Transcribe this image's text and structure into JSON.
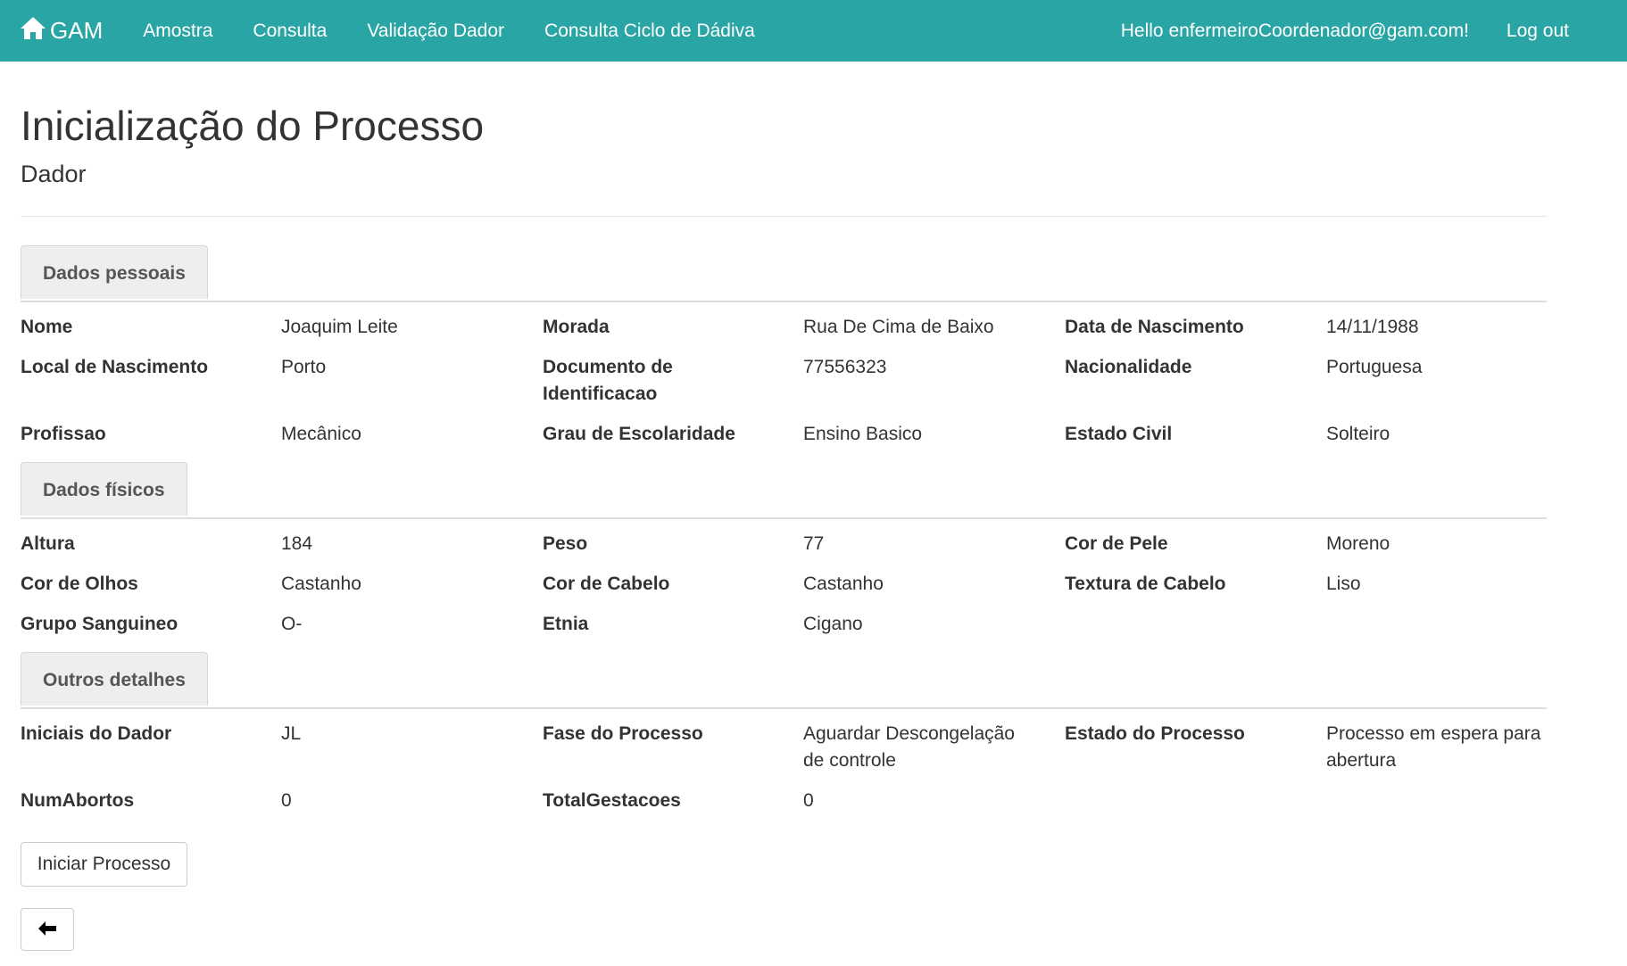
{
  "navbar": {
    "brand": "GAM",
    "links": [
      "Amostra",
      "Consulta",
      "Validação Dador",
      "Consulta Ciclo de Dádiva"
    ],
    "greeting": "Hello enfermeiroCoordenador@gam.com!",
    "logout": "Log out",
    "color": "#2aa5a5"
  },
  "page": {
    "title": "Inicialização do Processo",
    "subtitle": "Dador"
  },
  "sections": {
    "dados_pessoais": {
      "tab": "Dados pessoais",
      "nome": {
        "label": "Nome",
        "value": "Joaquim Leite"
      },
      "morada": {
        "label": "Morada",
        "value": "Rua De Cima de Baixo"
      },
      "data_nascimento": {
        "label": "Data de Nascimento",
        "value": "14/11/1988"
      },
      "local_nascimento": {
        "label": "Local de Nascimento",
        "value": "Porto"
      },
      "documento": {
        "label_line1": "Documento de",
        "label_line2": "Identificacao",
        "value": "77556323"
      },
      "nacionalidade": {
        "label": "Nacionalidade",
        "value": "Portuguesa"
      },
      "profissao": {
        "label": "Profissao",
        "value": "Mecânico"
      },
      "escolaridade": {
        "label": "Grau de Escolaridade",
        "value": "Ensino Basico"
      },
      "estado_civil": {
        "label": "Estado Civil",
        "value": "Solteiro"
      }
    },
    "dados_fisicos": {
      "tab": "Dados físicos",
      "altura": {
        "label": "Altura",
        "value": "184"
      },
      "peso": {
        "label": "Peso",
        "value": "77"
      },
      "cor_pele": {
        "label": "Cor de Pele",
        "value": "Moreno"
      },
      "cor_olhos": {
        "label": "Cor de Olhos",
        "value": "Castanho"
      },
      "cor_cabelo": {
        "label": "Cor de Cabelo",
        "value": "Castanho"
      },
      "textura_cabelo": {
        "label": "Textura de Cabelo",
        "value": "Liso"
      },
      "grupo_sanguineo": {
        "label": "Grupo Sanguineo",
        "value": "O-"
      },
      "etnia": {
        "label": "Etnia",
        "value": "Cigano"
      }
    },
    "outros_detalhes": {
      "tab": "Outros detalhes",
      "iniciais": {
        "label": "Iniciais do Dador",
        "value": "JL"
      },
      "fase": {
        "label": "Fase do Processo",
        "value_line1": "Aguardar Descongelação",
        "value_line2": "de controle"
      },
      "estado": {
        "label": "Estado do Processo",
        "value_line1": "Processo em espera para",
        "value_line2": "abertura"
      },
      "num_abortos": {
        "label": "NumAbortos",
        "value": "0"
      },
      "total_gestacoes": {
        "label": "TotalGestacoes",
        "value": "0"
      }
    }
  },
  "actions": {
    "iniciar": "Iniciar Processo",
    "back_icon": "arrow-left-icon"
  }
}
